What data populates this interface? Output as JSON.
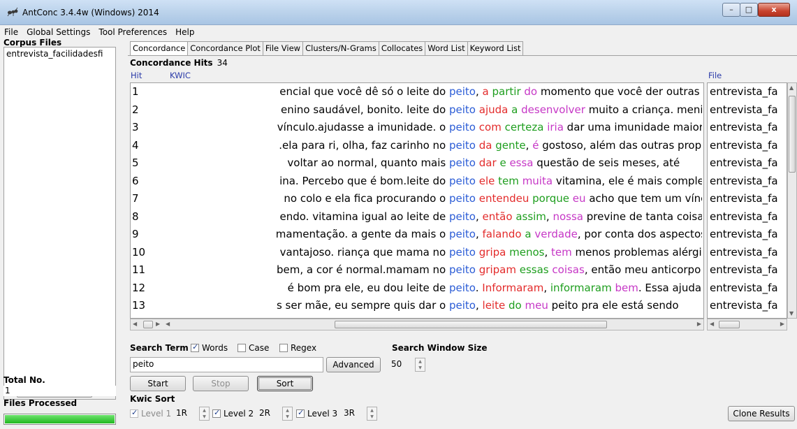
{
  "window": {
    "title": "AntConc 3.4.4w (Windows) 2014",
    "buttons": {
      "minimize": "–",
      "maximize": "□",
      "close": "x"
    }
  },
  "menu": [
    "File",
    "Global Settings",
    "Tool Preferences",
    "Help"
  ],
  "sidebar": {
    "corpus_files_label": "Corpus Files",
    "files": [
      "entrevista_facilidadesfi"
    ],
    "total_no_label": "Total No.",
    "total_no_value": "1",
    "files_processed_label": "Files Processed",
    "progress": 1.0
  },
  "tabs": [
    "Concordance",
    "Concordance Plot",
    "File View",
    "Clusters/N-Grams",
    "Collocates",
    "Word List",
    "Keyword List"
  ],
  "concordance": {
    "hits_label": "Concordance Hits",
    "hits_count": "34",
    "col_hit": "Hit",
    "col_kwic": "KWIC",
    "col_file": "File",
    "rows": [
      {
        "num": "1",
        "pre": "encial que você dê só o leite do ",
        "kw": "peito",
        "post": [
          [
            ", ",
            ""
          ],
          [
            "a",
            "r"
          ],
          [
            " ",
            ""
          ],
          [
            "partir",
            "g"
          ],
          [
            " ",
            ""
          ],
          [
            "do",
            "m"
          ],
          [
            " momento que você der outras",
            ""
          ]
        ],
        "file": "entrevista_fa"
      },
      {
        "num": "2",
        "pre": "enino saudável, bonito. leite do ",
        "kw": "peito",
        "post": [
          [
            " ",
            ""
          ],
          [
            "ajuda",
            "r"
          ],
          [
            " ",
            ""
          ],
          [
            "a",
            "g"
          ],
          [
            " ",
            ""
          ],
          [
            "desenvolver",
            "m"
          ],
          [
            " muito a criança. menino",
            ""
          ]
        ],
        "file": "entrevista_fa"
      },
      {
        "num": "3",
        "pre": "vínculo.ajudasse a imunidade. o ",
        "kw": "peito",
        "post": [
          [
            " ",
            ""
          ],
          [
            "com",
            "r"
          ],
          [
            " ",
            ""
          ],
          [
            "certeza",
            "g"
          ],
          [
            " ",
            ""
          ],
          [
            "iria",
            "m"
          ],
          [
            " dar uma imunidade maior, é",
            ""
          ]
        ],
        "file": "entrevista_fa"
      },
      {
        "num": "4",
        "pre": ".ela para ri, olha, faz carinho no ",
        "kw": "peito",
        "post": [
          [
            " ",
            ""
          ],
          [
            "da",
            "r"
          ],
          [
            " ",
            ""
          ],
          [
            "gente",
            "g"
          ],
          [
            ", ",
            ""
          ],
          [
            "é",
            "m"
          ],
          [
            " gostoso, além das outras proprie",
            ""
          ]
        ],
        "file": "entrevista_fa"
      },
      {
        "num": "5",
        "pre": "voltar ao normal, quanto mais ",
        "kw": "peito",
        "post": [
          [
            " ",
            ""
          ],
          [
            "dar",
            "r"
          ],
          [
            " ",
            ""
          ],
          [
            "e",
            "g"
          ],
          [
            " ",
            ""
          ],
          [
            "essa",
            "m"
          ],
          [
            " questão de seis meses, até",
            ""
          ]
        ],
        "file": "entrevista_fa"
      },
      {
        "num": "6",
        "pre": "ina. Percebo que é bom.leite do ",
        "kw": "peito",
        "post": [
          [
            " ",
            ""
          ],
          [
            "ele",
            "r"
          ],
          [
            " ",
            ""
          ],
          [
            "tem",
            "g"
          ],
          [
            " ",
            ""
          ],
          [
            "muita",
            "m"
          ],
          [
            " vitamina, ele é mais completo.",
            ""
          ]
        ],
        "file": "entrevista_fa"
      },
      {
        "num": "7",
        "pre": "no colo e ela fica procurando o ",
        "kw": "peito",
        "post": [
          [
            " ",
            ""
          ],
          [
            "entendeu",
            "r"
          ],
          [
            " ",
            ""
          ],
          [
            "porque",
            "g"
          ],
          [
            " ",
            ""
          ],
          [
            "eu",
            "m"
          ],
          [
            " acho que tem um vínculo",
            ""
          ]
        ],
        "file": "entrevista_fa"
      },
      {
        "num": "8",
        "pre": "endo. vitamina igual ao leite de ",
        "kw": "peito",
        "post": [
          [
            ", ",
            ""
          ],
          [
            "então",
            "r"
          ],
          [
            " ",
            ""
          ],
          [
            "assim",
            "g"
          ],
          [
            ", ",
            ""
          ],
          [
            "nossa",
            "m"
          ],
          [
            " previne de tanta coisa.",
            ""
          ]
        ],
        "file": "entrevista_fa"
      },
      {
        "num": "9",
        "pre": "mamentação. a gente da mais o ",
        "kw": "peito",
        "post": [
          [
            ", ",
            ""
          ],
          [
            "falando",
            "r"
          ],
          [
            " ",
            ""
          ],
          [
            "a",
            "g"
          ],
          [
            " ",
            ""
          ],
          [
            "verdade",
            "m"
          ],
          [
            ", por conta dos aspectos f",
            ""
          ]
        ],
        "file": "entrevista_fa"
      },
      {
        "num": "10",
        "pre": "vantajoso. riança que mama no ",
        "kw": "peito",
        "post": [
          [
            " ",
            ""
          ],
          [
            "gripa",
            "r"
          ],
          [
            " ",
            ""
          ],
          [
            "menos",
            "g"
          ],
          [
            ", ",
            ""
          ],
          [
            "tem",
            "m"
          ],
          [
            " menos problemas alérgicos.",
            ""
          ]
        ],
        "file": "entrevista_fa"
      },
      {
        "num": "11",
        "pre": "bem, a cor é normal.mamam no ",
        "kw": "peito",
        "post": [
          [
            " ",
            ""
          ],
          [
            "gripam",
            "r"
          ],
          [
            " ",
            ""
          ],
          [
            "essas",
            "g"
          ],
          [
            " ",
            ""
          ],
          [
            "coisas",
            "m"
          ],
          [
            ", então meu anticorpo pra",
            ""
          ]
        ],
        "file": "entrevista_fa"
      },
      {
        "num": "12",
        "pre": "é bom pra ele, eu dou leite de ",
        "kw": "peito",
        "post": [
          [
            ". ",
            ""
          ],
          [
            "Informaram",
            "r"
          ],
          [
            ", ",
            ""
          ],
          [
            "informaram",
            "g"
          ],
          [
            " ",
            ""
          ],
          [
            "bem",
            "m"
          ],
          [
            ". Essa ajuda é ót",
            ""
          ]
        ],
        "file": "entrevista_fa"
      },
      {
        "num": "13",
        "pre": "s ser mãe, eu sempre quis dar o ",
        "kw": "peito",
        "post": [
          [
            ", ",
            ""
          ],
          [
            "leite",
            "r"
          ],
          [
            " ",
            ""
          ],
          [
            "do",
            "g"
          ],
          [
            " ",
            ""
          ],
          [
            "meu",
            "m"
          ],
          [
            " peito pra ele está sendo",
            ""
          ]
        ],
        "file": "entrevista_fa"
      }
    ]
  },
  "search": {
    "term_label": "Search Term",
    "words_label": "Words",
    "case_label": "Case",
    "regex_label": "Regex",
    "words_checked": true,
    "case_checked": false,
    "regex_checked": false,
    "term_value": "peito",
    "advanced_label": "Advanced",
    "window_size_label": "Search Window Size",
    "window_size_value": "50",
    "start_label": "Start",
    "stop_label": "Stop",
    "sort_label": "Sort"
  },
  "kwic_sort": {
    "label": "Kwic Sort",
    "level1_label": "Level 1",
    "level1_value": "1R",
    "level2_label": "Level 2",
    "level2_value": "2R",
    "level3_label": "Level 3",
    "level3_value": "3R",
    "clone_label": "Clone Results"
  }
}
